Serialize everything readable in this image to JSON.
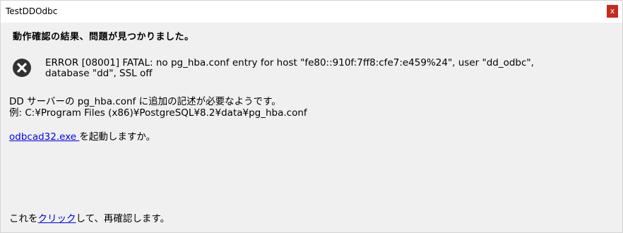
{
  "window": {
    "title": "TestDDOdbc",
    "close_label": "x"
  },
  "dialog": {
    "headline": "動作確認の結果、問題が見つかりました。",
    "error_icon": "error-x-circle-icon",
    "error_line_1": "ERROR [08001] FATAL:  no pg_hba.conf entry for host \"fe80::910f:7ff8:cfe7:e459%24\", user \"dd_odbc\",",
    "error_line_2": "database \"dd\", SSL off",
    "info_line_1": "DD サーバーの pg_hba.conf に追加の記述が必要なようです。",
    "info_line_2": "例: C:¥Program Files (x86)¥PostgreSQL¥8.2¥data¥pg_hba.conf",
    "launch_link": "odbcad32.exe ",
    "launch_suffix": "を起動しますか。",
    "recheck_prefix": "これを",
    "recheck_link": "クリック",
    "recheck_suffix": "して、再確認します。"
  },
  "colors": {
    "link": "#0000ee",
    "close_button": "#c42b1c",
    "background": "#f0f0f0",
    "icon": "#333333"
  }
}
